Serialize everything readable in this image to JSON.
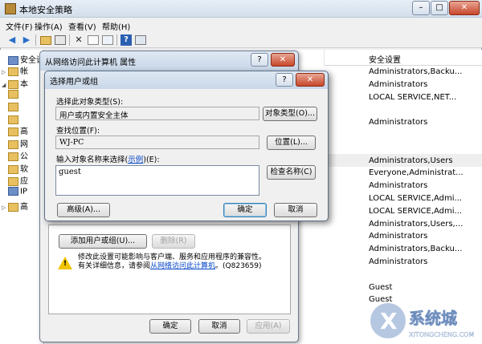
{
  "window": {
    "title": "本地安全策略",
    "minimize": "–",
    "maximize": "□",
    "close": "✕"
  },
  "menu": [
    "文件(F)",
    "操作(A)",
    "查看(V)",
    "帮助(H)"
  ],
  "toolbar_icons": [
    "back-arrow-icon",
    "forward-arrow-icon",
    "up-folder-icon",
    "show-hide-tree-icon",
    "delete-icon",
    "properties-icon",
    "export-list-icon",
    "help-icon",
    "mmc-icon"
  ],
  "tree": [
    {
      "exp": "",
      "label": "安全设"
    },
    {
      "exp": "▷",
      "label": "帐"
    },
    {
      "exp": "◢",
      "label": "本"
    },
    {
      "exp": "",
      "label": ""
    },
    {
      "exp": "",
      "label": ""
    },
    {
      "exp": "",
      "label": ""
    },
    {
      "exp": "",
      "label": "高"
    },
    {
      "exp": "",
      "label": "网"
    },
    {
      "exp": "",
      "label": "公"
    },
    {
      "exp": "",
      "label": "软"
    },
    {
      "exp": "",
      "label": "应"
    },
    {
      "exp": "",
      "label": "IP"
    },
    {
      "exp": "▷",
      "label": "高"
    }
  ],
  "list": {
    "header": "安全设置",
    "rows": [
      "Administrators,Backu...",
      "Administrators",
      "LOCAL SERVICE,NET...",
      "",
      "Administrators",
      "",
      "",
      "Administrators,Users",
      "Everyone,Administrat...",
      "Administrators",
      "LOCAL SERVICE,Admi...",
      "LOCAL SERVICE,Admi...",
      "Administrators,Users,...",
      "Administrators",
      "Administrators,Backu...",
      "Administrators",
      "",
      "Guest",
      "Guest"
    ]
  },
  "props_dialog": {
    "title": "从网络访问此计算机 属性",
    "help": "?",
    "close": "✕",
    "add_button": "添加用户或组(U)...",
    "remove_button": "删除(R)",
    "warning_line1": "修改此设置可能影响与客户端、服务和应用程序的兼容性。",
    "warning_line2_prefix": "有关详细信息，请参阅",
    "warning_link": "从网络访问此计算机",
    "warning_kb": "。(Q823659)",
    "ok": "确定",
    "cancel": "取消",
    "apply": "应用(A)"
  },
  "select_dialog": {
    "title": "选择用户或组",
    "help": "?",
    "close": "✕",
    "object_type_label": "选择此对象类型(S):",
    "object_type_value": "用户或内置安全主体",
    "object_type_button": "对象类型(O)...",
    "location_label": "查找位置(F):",
    "location_value": "WJ-PC",
    "location_button": "位置(L)...",
    "names_label_prefix": "输入对象名称来选择(",
    "names_label_link": "示例",
    "names_label_suffix": ")(E):",
    "names_value": "guest",
    "check_names_button": "检查名称(C)",
    "advanced_button": "高级(A)...",
    "ok": "确定",
    "cancel": "取消"
  },
  "watermark": {
    "brand": "系统城",
    "url": "XITONGCHENG.COM"
  }
}
